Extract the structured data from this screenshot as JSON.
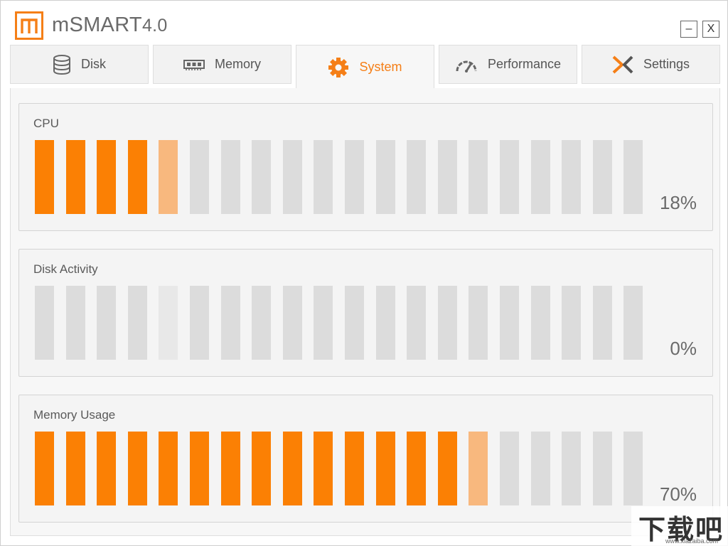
{
  "app": {
    "title": "mSMART",
    "version": "4.0",
    "minimize_label": "–",
    "close_label": "X",
    "accent_color": "#f57f17"
  },
  "tabs": [
    {
      "label": "Disk",
      "icon": "database-icon",
      "active": false
    },
    {
      "label": "Memory",
      "icon": "memory-chip-icon",
      "active": false
    },
    {
      "label": "System",
      "icon": "gear-icon",
      "active": true
    },
    {
      "label": "Performance",
      "icon": "speedometer-icon",
      "active": false
    },
    {
      "label": "Settings",
      "icon": "tools-icon",
      "active": false
    }
  ],
  "panels": [
    {
      "title": "CPU",
      "percent_label": "18%",
      "segments_total": 20,
      "segments_on": 4,
      "segments_partial": 1
    },
    {
      "title": "Disk Activity",
      "percent_label": "0%",
      "segments_total": 20,
      "segments_on": 0,
      "segments_partial": 0
    },
    {
      "title": "Memory Usage",
      "percent_label": "70%",
      "segments_total": 20,
      "segments_on": 14,
      "segments_partial": 1
    }
  ],
  "colors": {
    "bar_on": "#fb8004",
    "bar_partial": "#f8b87e",
    "bar_off": "#dcdcdc"
  },
  "watermark": {
    "text": "下载吧",
    "sub": "www.xiazaiba.com"
  }
}
